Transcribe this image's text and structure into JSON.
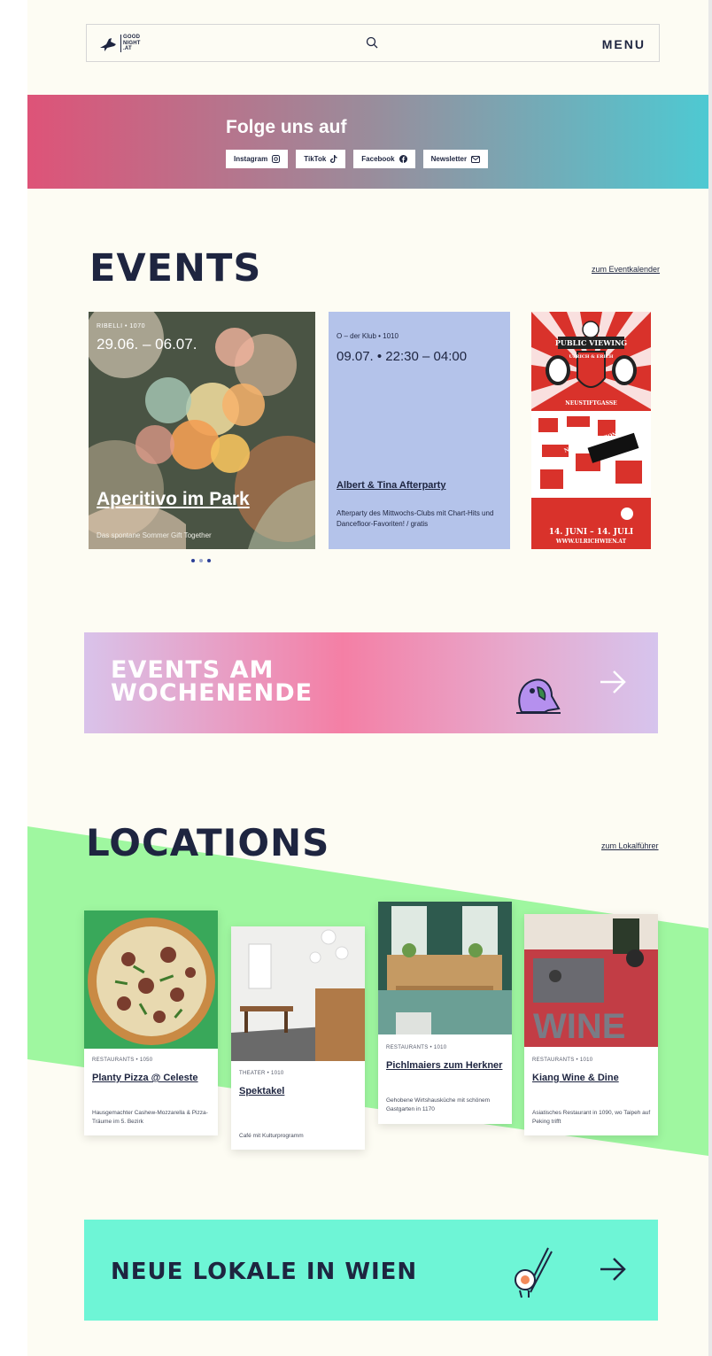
{
  "header": {
    "logo_line1": "GOOD",
    "logo_line2": "NIGHT",
    "logo_line3": ".AT",
    "menu_label": "MENU"
  },
  "social": {
    "title": "Folge uns auf",
    "links": [
      {
        "label": "Instagram",
        "icon": "instagram-icon"
      },
      {
        "label": "TikTok",
        "icon": "tiktok-icon"
      },
      {
        "label": "Facebook",
        "icon": "facebook-icon"
      },
      {
        "label": "Newsletter",
        "icon": "mail-icon"
      }
    ]
  },
  "events": {
    "title": "EVENTS",
    "calendar_link": "zum Eventkalender",
    "cards": [
      {
        "meta": "RIBELLI • 1070",
        "date": "29.06. – 06.07.",
        "title": "Aperitivo im Park",
        "desc": "Das spontane Sommer Gift Together"
      },
      {
        "meta": "O – der Klub • 1010",
        "date": "09.07. • 22:30 – 04:00",
        "title": "Albert & Tina Afterparty",
        "desc": "Afterparty des Mittwochs-Clubs mit Chart-Hits und Dancefloor-Favoriten! / gratis"
      },
      {
        "poster_top": "PUBLIC VIEWING",
        "poster_sub": "ULRICH & ERICH",
        "poster_street": "NEUSTIFTGASSE",
        "poster_sign": "NO RESERVATIONS Sorry!",
        "poster_dates": "14. JUNI – 14. JULI",
        "poster_url": "WWW.ULRICHWIEN.AT"
      }
    ],
    "pagination_active": 0
  },
  "weekend_banner": {
    "line1": "EVENTS AM",
    "line2": "WOCHENENDE"
  },
  "locations": {
    "title": "LOCATIONS",
    "guide_link": "zum Lokalführer",
    "cards": [
      {
        "meta": "RESTAURANTS • 1050",
        "title": "Planty Pizza @ Celeste",
        "desc": "Hausgemachter Cashew-Mozzarella & Pizza-Träume im 5. Bezirk"
      },
      {
        "meta": "THEATER • 1010",
        "title": "Spektakel",
        "desc": "Café mit Kulturprogramm"
      },
      {
        "meta": "RESTAURANTS • 1010",
        "title": "Pichlmaiers zum Herkner",
        "desc": "Gehobene Wirtshausküche mit schönem Gastgarten in 1170"
      },
      {
        "meta": "RESTAURANTS • 1010",
        "title": "Kiang Wine & Dine",
        "desc": "Asiatisches Restaurant in 1090, wo Taipeh auf Peking trifft"
      }
    ]
  },
  "neue_banner": {
    "title": "NEUE LOKALE IN WIEN"
  },
  "colors": {
    "navy": "#1e2540",
    "cream": "#fdfcf3",
    "green": "#9ff7a0",
    "mint": "#6ef5d6",
    "lavender": "#b4c3ea",
    "poster_red": "#d9322b"
  }
}
